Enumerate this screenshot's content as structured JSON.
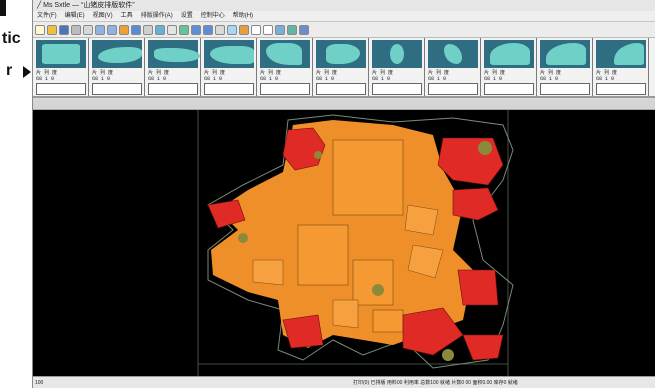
{
  "side_labels": {
    "line1": "tic",
    "line2": "r"
  },
  "window": {
    "title": "╱ Ms Sxtle — “山猪皮排版软件”",
    "menu": [
      "文件(F)",
      "编辑(E)",
      "视图(V)",
      "工具",
      "排版操作(A)",
      "设置",
      "控制中心",
      "帮助(H)"
    ]
  },
  "pieces": [
    {
      "info1": "片  列  度",
      "info2": "68  1   0"
    },
    {
      "info1": "片  列  度",
      "info2": "68  1   0"
    },
    {
      "info1": "片  列  度",
      "info2": "68  1   0"
    },
    {
      "info1": "片  列  度",
      "info2": "68  1   0"
    },
    {
      "info1": "片  列  度",
      "info2": "68  1   0"
    },
    {
      "info1": "片  列  度",
      "info2": "68  1   0"
    },
    {
      "info1": "片  列  度",
      "info2": "68  1   0"
    },
    {
      "info1": "片  列  度",
      "info2": "68  1   0"
    },
    {
      "info1": "片  列  度",
      "info2": "68  1   0"
    },
    {
      "info1": "片  列  度",
      "info2": "68  1   0"
    },
    {
      "info1": "片  列  度",
      "info2": "68  1   0"
    }
  ],
  "status": {
    "left": "100",
    "right": "打印(0)  已排版 用料00 利用率 总数100 就绪  片数0 00 面积0.00  库存0  就绪"
  },
  "colors": {
    "piece_red": "#e02a25",
    "piece_orange": "#ef8f2a",
    "piece_olive": "#8c8a3a",
    "hide_outline": "#7a8a7a",
    "thumb_bg": "#2f6d82",
    "thumb_piece": "#6fd0c7"
  }
}
